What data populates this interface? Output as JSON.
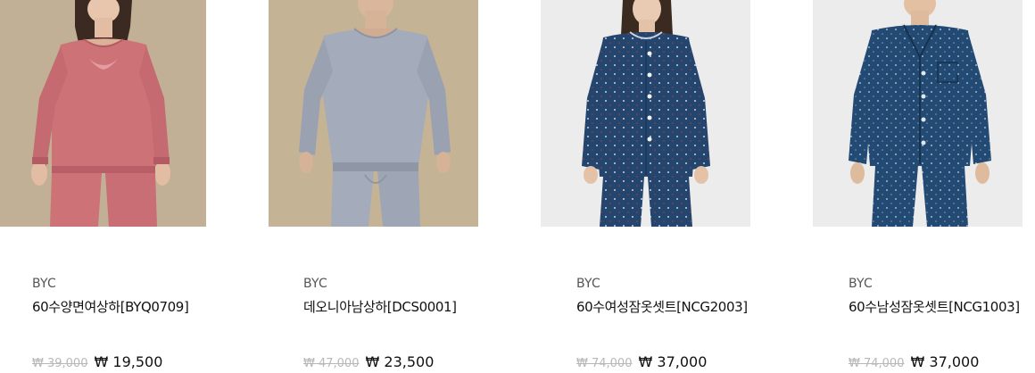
{
  "products": [
    {
      "brand": "BYC",
      "name": "60수양면여상하[BYQ0709]",
      "original_price": "₩ 39,000",
      "sale_price": "₩ 19,500",
      "image": {
        "subject": "woman-pink-thermal-set",
        "background": "#b9a78e",
        "garment": "#cd7378"
      }
    },
    {
      "brand": "BYC",
      "name": "데오니아남상하[DCS0001]",
      "original_price": "₩ 47,000",
      "sale_price": "₩ 23,500",
      "image": {
        "subject": "man-grey-thermal-set",
        "background": "#c5b395",
        "garment": "#a4abbb"
      }
    },
    {
      "brand": "BYC",
      "name": "60수여성잠옷셋트[NCG2003]",
      "original_price": "₩ 74,000",
      "sale_price": "₩ 37,000",
      "image": {
        "subject": "woman-navy-dot-pajamas",
        "background": "#ececec",
        "garment": "#24466e"
      }
    },
    {
      "brand": "BYC",
      "name": "60수남성잠옷셋트[NCG1003]",
      "original_price": "₩ 74,000",
      "sale_price": "₩ 37,000",
      "image": {
        "subject": "man-navy-dot-pajamas",
        "background": "#ececec",
        "garment": "#234a73"
      }
    }
  ]
}
